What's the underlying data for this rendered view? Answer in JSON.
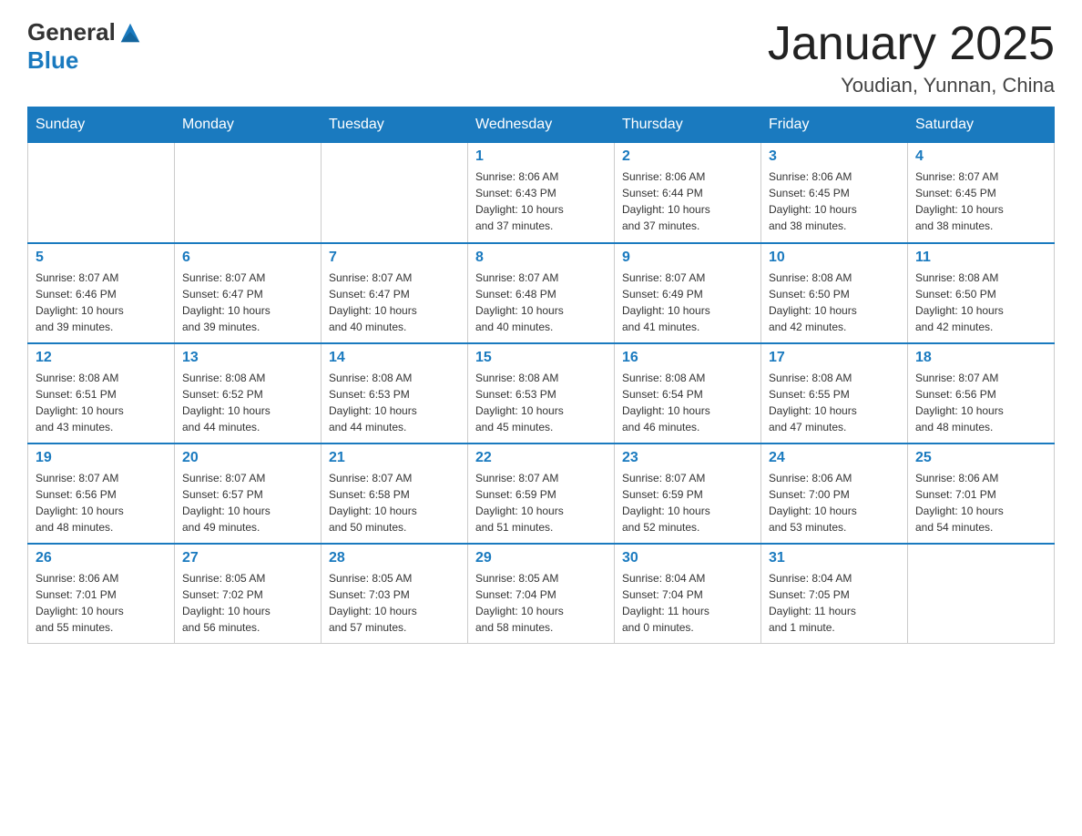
{
  "header": {
    "logo_general": "General",
    "logo_blue": "Blue",
    "month_title": "January 2025",
    "location": "Youdian, Yunnan, China"
  },
  "days_of_week": [
    "Sunday",
    "Monday",
    "Tuesday",
    "Wednesday",
    "Thursday",
    "Friday",
    "Saturday"
  ],
  "weeks": [
    [
      {
        "day": "",
        "info": ""
      },
      {
        "day": "",
        "info": ""
      },
      {
        "day": "",
        "info": ""
      },
      {
        "day": "1",
        "info": "Sunrise: 8:06 AM\nSunset: 6:43 PM\nDaylight: 10 hours\nand 37 minutes."
      },
      {
        "day": "2",
        "info": "Sunrise: 8:06 AM\nSunset: 6:44 PM\nDaylight: 10 hours\nand 37 minutes."
      },
      {
        "day": "3",
        "info": "Sunrise: 8:06 AM\nSunset: 6:45 PM\nDaylight: 10 hours\nand 38 minutes."
      },
      {
        "day": "4",
        "info": "Sunrise: 8:07 AM\nSunset: 6:45 PM\nDaylight: 10 hours\nand 38 minutes."
      }
    ],
    [
      {
        "day": "5",
        "info": "Sunrise: 8:07 AM\nSunset: 6:46 PM\nDaylight: 10 hours\nand 39 minutes."
      },
      {
        "day": "6",
        "info": "Sunrise: 8:07 AM\nSunset: 6:47 PM\nDaylight: 10 hours\nand 39 minutes."
      },
      {
        "day": "7",
        "info": "Sunrise: 8:07 AM\nSunset: 6:47 PM\nDaylight: 10 hours\nand 40 minutes."
      },
      {
        "day": "8",
        "info": "Sunrise: 8:07 AM\nSunset: 6:48 PM\nDaylight: 10 hours\nand 40 minutes."
      },
      {
        "day": "9",
        "info": "Sunrise: 8:07 AM\nSunset: 6:49 PM\nDaylight: 10 hours\nand 41 minutes."
      },
      {
        "day": "10",
        "info": "Sunrise: 8:08 AM\nSunset: 6:50 PM\nDaylight: 10 hours\nand 42 minutes."
      },
      {
        "day": "11",
        "info": "Sunrise: 8:08 AM\nSunset: 6:50 PM\nDaylight: 10 hours\nand 42 minutes."
      }
    ],
    [
      {
        "day": "12",
        "info": "Sunrise: 8:08 AM\nSunset: 6:51 PM\nDaylight: 10 hours\nand 43 minutes."
      },
      {
        "day": "13",
        "info": "Sunrise: 8:08 AM\nSunset: 6:52 PM\nDaylight: 10 hours\nand 44 minutes."
      },
      {
        "day": "14",
        "info": "Sunrise: 8:08 AM\nSunset: 6:53 PM\nDaylight: 10 hours\nand 44 minutes."
      },
      {
        "day": "15",
        "info": "Sunrise: 8:08 AM\nSunset: 6:53 PM\nDaylight: 10 hours\nand 45 minutes."
      },
      {
        "day": "16",
        "info": "Sunrise: 8:08 AM\nSunset: 6:54 PM\nDaylight: 10 hours\nand 46 minutes."
      },
      {
        "day": "17",
        "info": "Sunrise: 8:08 AM\nSunset: 6:55 PM\nDaylight: 10 hours\nand 47 minutes."
      },
      {
        "day": "18",
        "info": "Sunrise: 8:07 AM\nSunset: 6:56 PM\nDaylight: 10 hours\nand 48 minutes."
      }
    ],
    [
      {
        "day": "19",
        "info": "Sunrise: 8:07 AM\nSunset: 6:56 PM\nDaylight: 10 hours\nand 48 minutes."
      },
      {
        "day": "20",
        "info": "Sunrise: 8:07 AM\nSunset: 6:57 PM\nDaylight: 10 hours\nand 49 minutes."
      },
      {
        "day": "21",
        "info": "Sunrise: 8:07 AM\nSunset: 6:58 PM\nDaylight: 10 hours\nand 50 minutes."
      },
      {
        "day": "22",
        "info": "Sunrise: 8:07 AM\nSunset: 6:59 PM\nDaylight: 10 hours\nand 51 minutes."
      },
      {
        "day": "23",
        "info": "Sunrise: 8:07 AM\nSunset: 6:59 PM\nDaylight: 10 hours\nand 52 minutes."
      },
      {
        "day": "24",
        "info": "Sunrise: 8:06 AM\nSunset: 7:00 PM\nDaylight: 10 hours\nand 53 minutes."
      },
      {
        "day": "25",
        "info": "Sunrise: 8:06 AM\nSunset: 7:01 PM\nDaylight: 10 hours\nand 54 minutes."
      }
    ],
    [
      {
        "day": "26",
        "info": "Sunrise: 8:06 AM\nSunset: 7:01 PM\nDaylight: 10 hours\nand 55 minutes."
      },
      {
        "day": "27",
        "info": "Sunrise: 8:05 AM\nSunset: 7:02 PM\nDaylight: 10 hours\nand 56 minutes."
      },
      {
        "day": "28",
        "info": "Sunrise: 8:05 AM\nSunset: 7:03 PM\nDaylight: 10 hours\nand 57 minutes."
      },
      {
        "day": "29",
        "info": "Sunrise: 8:05 AM\nSunset: 7:04 PM\nDaylight: 10 hours\nand 58 minutes."
      },
      {
        "day": "30",
        "info": "Sunrise: 8:04 AM\nSunset: 7:04 PM\nDaylight: 11 hours\nand 0 minutes."
      },
      {
        "day": "31",
        "info": "Sunrise: 8:04 AM\nSunset: 7:05 PM\nDaylight: 11 hours\nand 1 minute."
      },
      {
        "day": "",
        "info": ""
      }
    ]
  ]
}
